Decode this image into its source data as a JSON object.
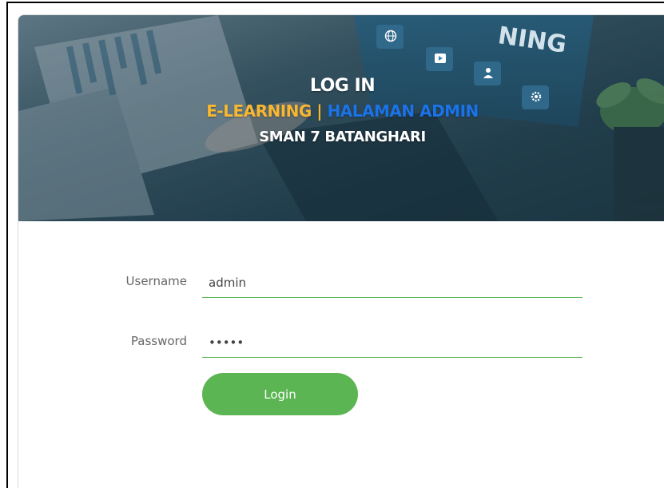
{
  "header": {
    "title": "LOG IN",
    "subtitle_part1": "E-LEARNING | ",
    "subtitle_part2": "HALAMAN ADMIN",
    "school": "SMAN 7 BATANGHARI",
    "banner_text": "NING"
  },
  "form": {
    "username_label": "Username",
    "username_value": "admin",
    "password_label": "Password",
    "password_value": "admin",
    "login_label": "Login"
  },
  "colors": {
    "accent_green": "#5ab552",
    "input_underline": "#5cb85c",
    "subtitle_yellow": "#f7b731",
    "subtitle_blue": "#1a73e8",
    "hero_overlay": "#1f3a48"
  },
  "icons": [
    "globe-icon",
    "play-icon",
    "user-icon",
    "gear-icon"
  ]
}
